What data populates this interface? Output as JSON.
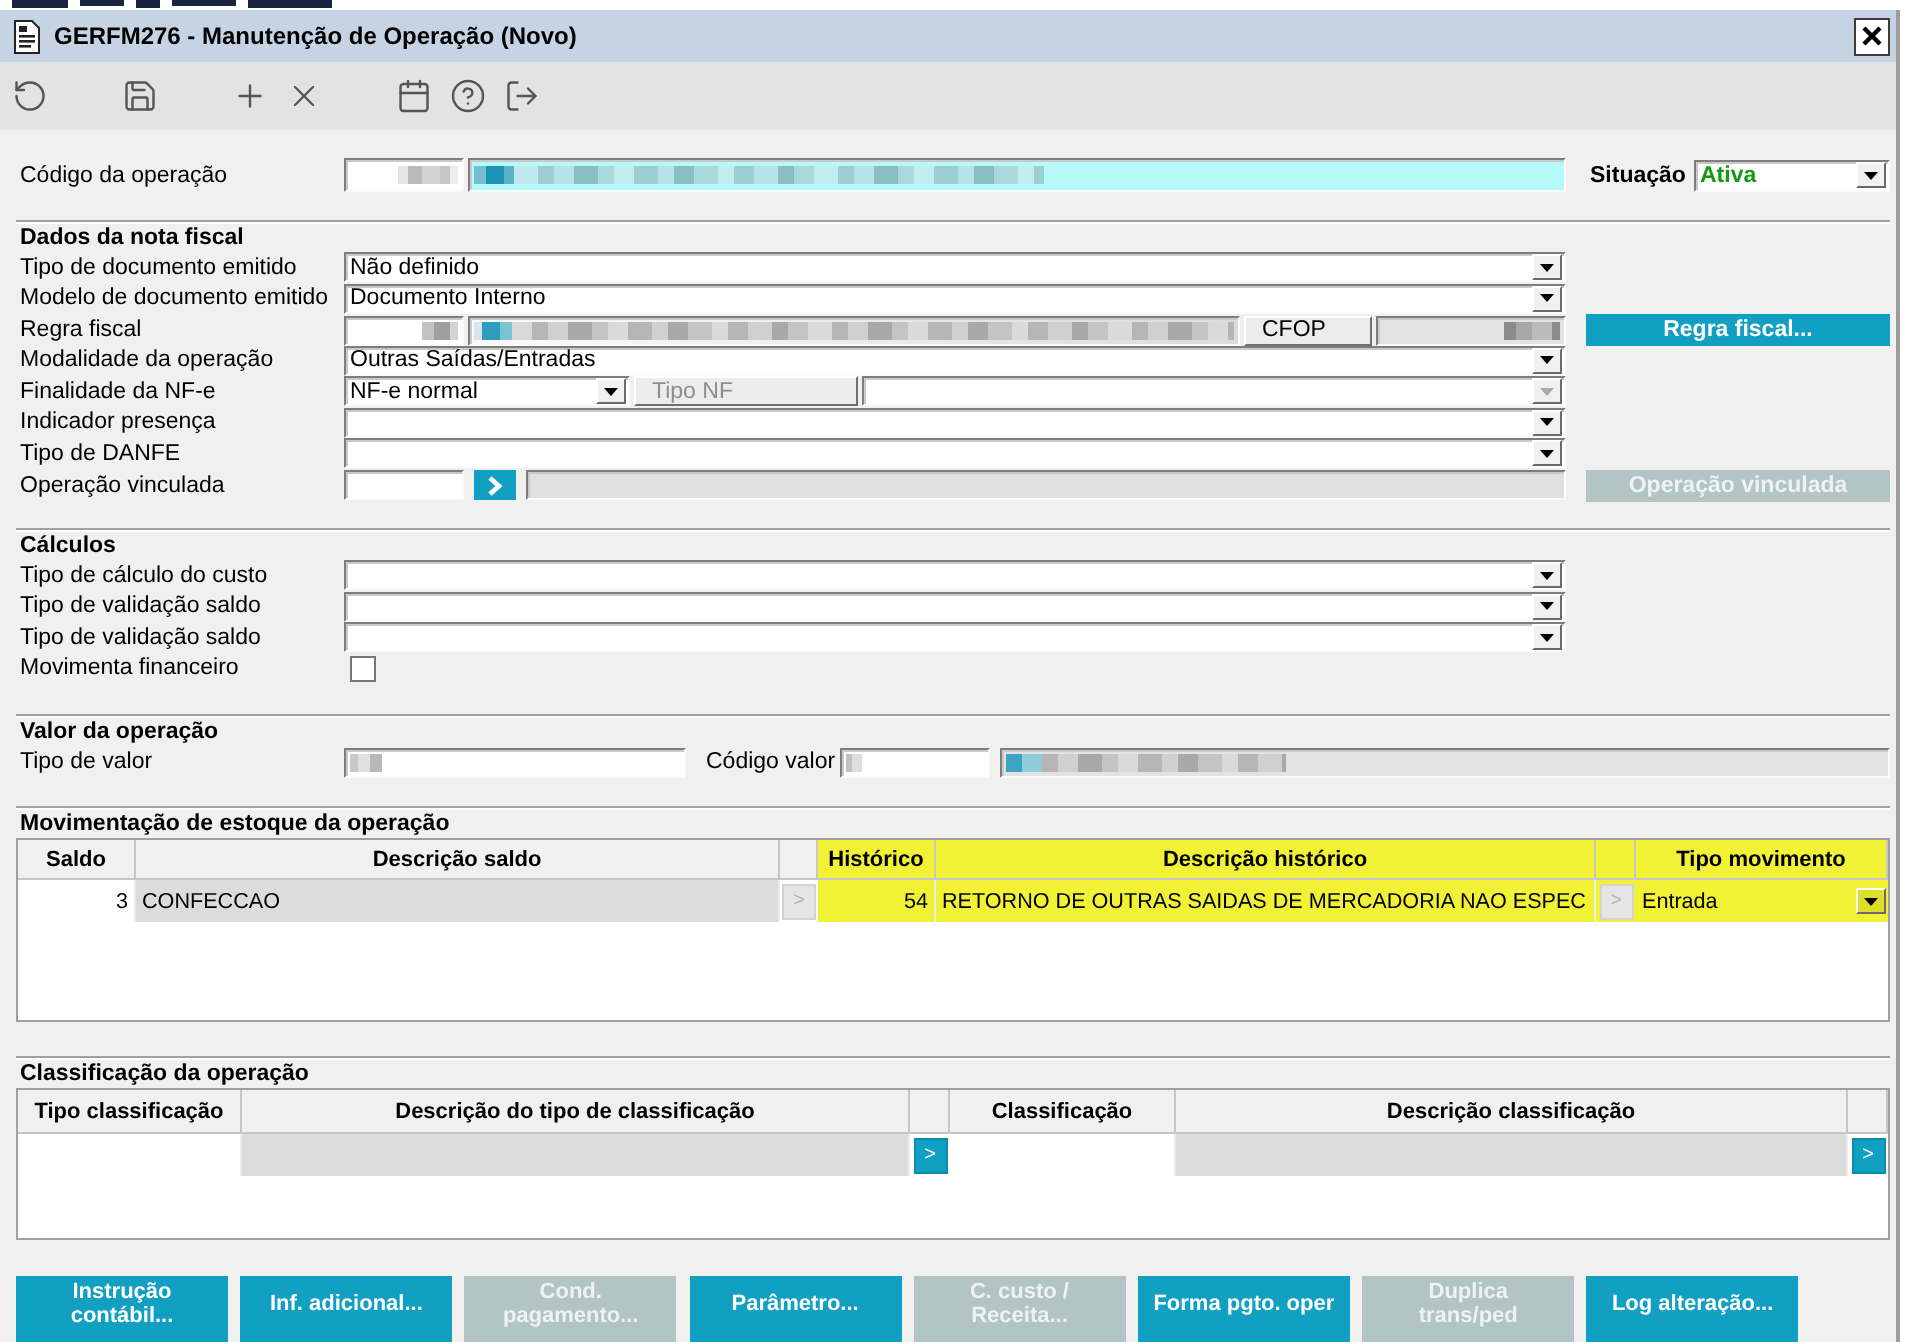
{
  "window": {
    "title": "GERFM276 - Manutenção de Operação (Novo)"
  },
  "operation": {
    "code_label": "Código da operação",
    "status_label": "Situação",
    "status_value": "Ativa"
  },
  "fiscal": {
    "title": "Dados da nota fiscal",
    "rows": [
      {
        "kind": "select",
        "label": "Tipo de documento emitido",
        "value": "Não definido"
      },
      {
        "kind": "select",
        "label": "Modelo de documento emitido",
        "value": "Documento Interno"
      },
      {
        "kind": "rule",
        "label": "Regra fiscal",
        "button": {
          "label": "CFOP",
          "disabled": false
        },
        "side_button": {
          "label": "Regra fiscal...",
          "disabled": false
        }
      },
      {
        "kind": "select",
        "label": "Modalidade da operação",
        "value": "Outras Saídas/Entradas"
      },
      {
        "kind": "purpose",
        "label": "Finalidade da NF-e",
        "value": "NF-e normal",
        "button": {
          "label": "Tipo NF",
          "disabled": true
        },
        "type_select": {
          "disabled": true
        }
      },
      {
        "kind": "select",
        "label": "Indicador presença"
      },
      {
        "kind": "select",
        "label": "Tipo de DANFE"
      },
      {
        "kind": "link",
        "label": "Operação vinculada",
        "side_button": {
          "label": "Operação vinculada",
          "disabled": true
        }
      }
    ]
  },
  "costs": {
    "title": "Cálculos",
    "rows": [
      {
        "kind": "select",
        "label": "Tipo de cálculo do custo"
      },
      {
        "kind": "select",
        "label": "Tipo de validação saldo"
      },
      {
        "kind": "select",
        "label": "Tipo de validação saldo"
      },
      {
        "kind": "checkbox",
        "label": "Movimenta financeiro",
        "checked": false
      }
    ]
  },
  "value": {
    "title": "Valor da operação",
    "type_label": "Tipo de valor",
    "code_label": "Código valor"
  },
  "stock": {
    "title": "Movimentação de estoque da operação",
    "lookups_disabled": true,
    "columns": [
      {
        "label": "Saldo",
        "kind": "code",
        "highlighted": false
      },
      {
        "label": "Descrição saldo",
        "kind": "description",
        "highlighted": false
      },
      {
        "label": "Histórico",
        "kind": "code",
        "highlighted": true
      },
      {
        "label": "Descrição histórico",
        "kind": "description",
        "highlighted": true
      },
      {
        "label": "Tipo movimento",
        "kind": "select",
        "highlighted": true
      }
    ],
    "rows": [
      {
        "cells": [
          "3",
          "CONFECCAO",
          "54",
          "RETORNO DE OUTRAS SAIDAS DE MERCADORIA NAO ESPEC",
          "Entrada"
        ],
        "lookups": [
          ">",
          ">"
        ]
      }
    ]
  },
  "classification": {
    "title": "Classificação da operação",
    "lookups_disabled": false,
    "columns": [
      {
        "label": "Tipo classificação",
        "kind": "code"
      },
      {
        "label": "Descrição do tipo de classificação",
        "kind": "description"
      },
      {
        "label": "Classificação",
        "kind": "code"
      },
      {
        "label": "Descrição classificação",
        "kind": "description"
      }
    ],
    "rows": [
      {
        "lookups": [
          ">",
          ">"
        ]
      }
    ]
  },
  "buttons": [
    {
      "label": "Instrução\ncontábil...",
      "disabled": false
    },
    {
      "label": "Inf. adicional...",
      "disabled": false
    },
    {
      "label": "Cond.\npagamento...",
      "disabled": true
    },
    {
      "label": "Parâmetro...",
      "disabled": false
    },
    {
      "label": "C. custo /\nReceita...",
      "disabled": true
    },
    {
      "label": "Forma pgto. oper",
      "disabled": false
    },
    {
      "label": "Duplica\ntrans/ped",
      "disabled": true
    },
    {
      "label": "Log alteração...",
      "disabled": false
    }
  ]
}
